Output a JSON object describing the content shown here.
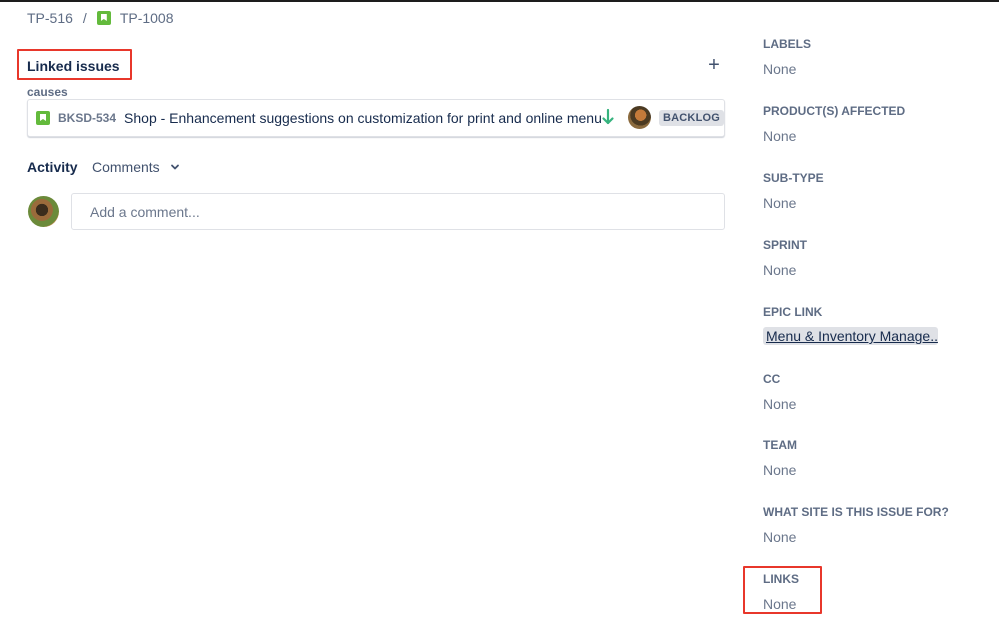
{
  "breadcrumb": {
    "parent": "TP-516",
    "separator": "/",
    "current": "TP-1008"
  },
  "linked_issues": {
    "title": "Linked issues",
    "add_label": "+",
    "link_type": "causes",
    "items": [
      {
        "key": "BKSD-534",
        "summary": "Shop - Enhancement suggestions on customization for print and online menu",
        "status": "BACKLOG"
      }
    ]
  },
  "activity": {
    "label": "Activity",
    "filter": "Comments",
    "comment_placeholder": "Add a comment..."
  },
  "fields": {
    "labels": {
      "label": "LABELS",
      "value": "None"
    },
    "products_affected": {
      "label": "PRODUCT(S) AFFECTED",
      "value": "None"
    },
    "sub_type": {
      "label": "SUB-TYPE",
      "value": "None"
    },
    "sprint": {
      "label": "SPRINT",
      "value": "None"
    },
    "epic_link": {
      "label": "EPIC LINK",
      "value": "Menu & Inventory Manage..."
    },
    "cc": {
      "label": "CC",
      "value": "None"
    },
    "team": {
      "label": "TEAM",
      "value": "None"
    },
    "site": {
      "label": "WHAT SITE IS THIS ISSUE FOR?",
      "value": "None"
    },
    "links": {
      "label": "LINKS",
      "value": "None"
    }
  },
  "colors": {
    "story_green": "#63ba3c",
    "priority_low_green": "#36b37e",
    "highlight_red": "#e8372b"
  },
  "icons": {
    "story": "story-icon",
    "priority": "arrow-down-icon",
    "chevron": "chevron-down-icon"
  }
}
